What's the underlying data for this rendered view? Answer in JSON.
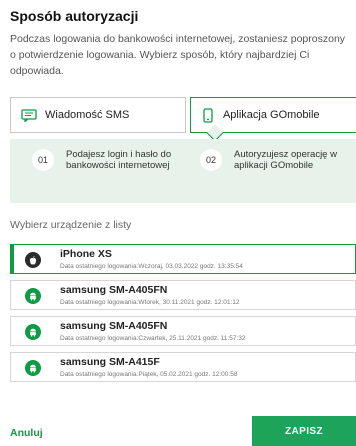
{
  "header": {
    "title": "Sposób autoryzacji",
    "description": "Podczas logowania do bankowości internetowej, zostaniesz poproszony o potwierdzenie logowania. Wybierz sposób, który najbardziej Ci odpowiada."
  },
  "methods": [
    {
      "label": "Wiadomość SMS",
      "icon": "sms-icon",
      "selected": false
    },
    {
      "label": "Aplikacja GOmobile",
      "icon": "phone-icon",
      "selected": true
    }
  ],
  "steps": [
    {
      "number": "01",
      "text": "Podajesz login i hasło do bankowości internetowej"
    },
    {
      "number": "02",
      "text": "Autoryzujesz operację w aplikacji GOmobile"
    }
  ],
  "device_list_label": "Wybierz urządzenie z listy",
  "devices": [
    {
      "name": "iPhone XS",
      "subtitle": "Data ostatniego logowania:Wczoraj, 03.03.2022 godz. 13:35:54",
      "icon": "apple-icon",
      "selected": true
    },
    {
      "name": "samsung SM-A405FN",
      "subtitle": "Data ostatniego logowania:Wtorek, 30.11.2021 godz. 12:01:12",
      "icon": "android-icon",
      "selected": false
    },
    {
      "name": "samsung SM-A405FN",
      "subtitle": "Data ostatniego logowania:Czwartek, 25.11.2021 godz. 11:57:32",
      "icon": "android-icon",
      "selected": false
    },
    {
      "name": "samsung SM-A415F",
      "subtitle": "Data ostatniego logowania:Piątek, 05.02.2021 godz. 12:00:58",
      "icon": "android-icon",
      "selected": false
    }
  ],
  "footer": {
    "cancel_label": "Anuluj",
    "save_label": "ZAPISZ"
  },
  "colors": {
    "accent": "#0f9a45",
    "button": "#1ea35a",
    "steps_background": "#e6f2ea"
  }
}
